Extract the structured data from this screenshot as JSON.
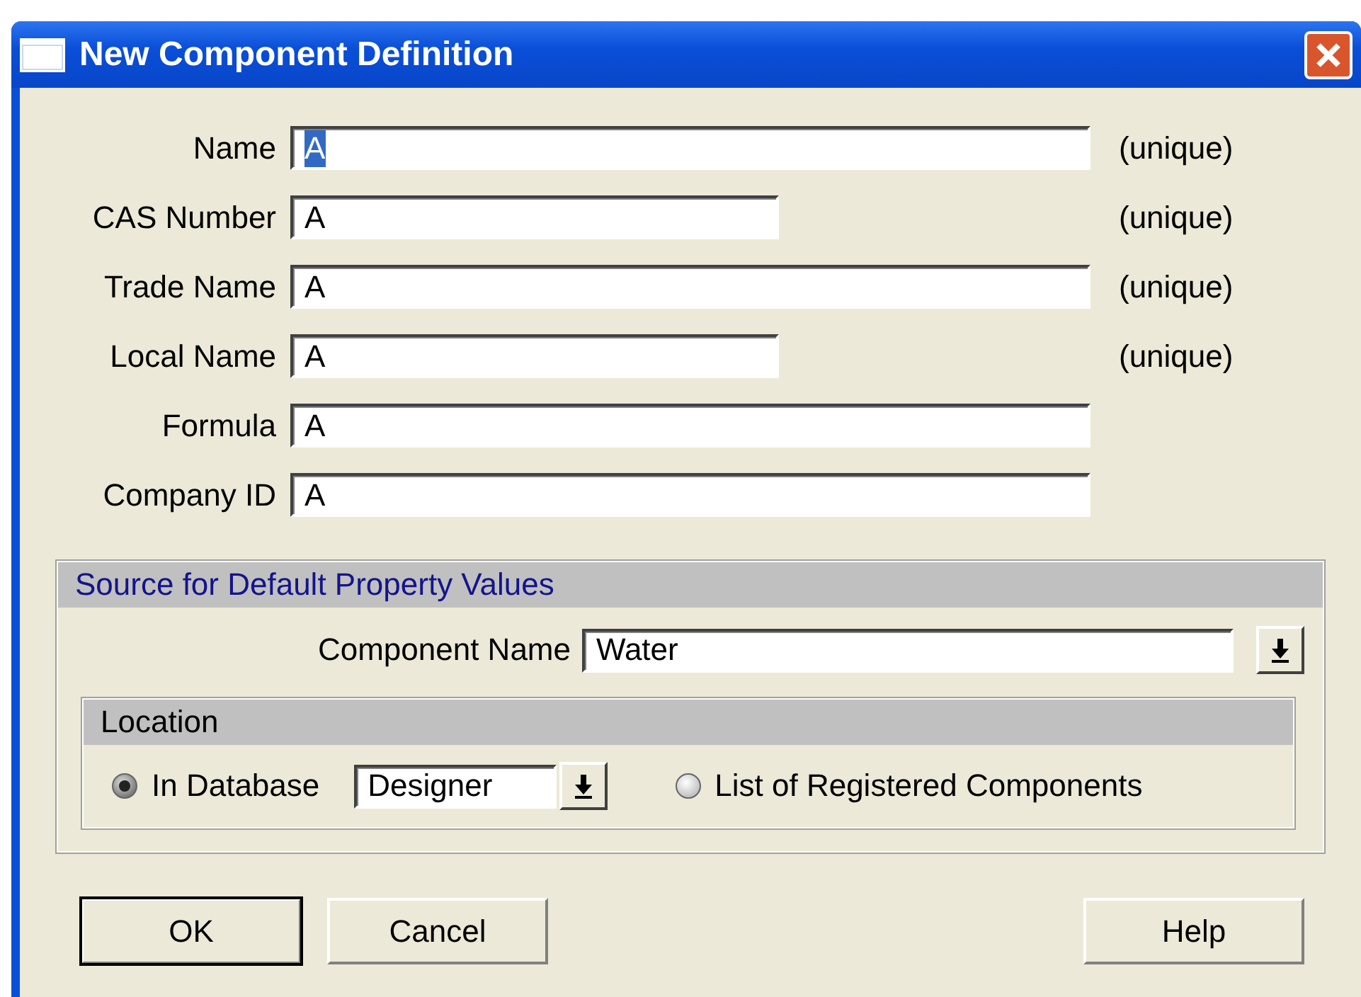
{
  "window": {
    "title": "New Component Definition"
  },
  "fields": [
    {
      "label": "Name",
      "value": "A",
      "kind": "wide",
      "text_selected": true,
      "note": "(unique)"
    },
    {
      "label": "CAS Number",
      "value": "A",
      "kind": "narrow",
      "text_selected": false,
      "note": "(unique)"
    },
    {
      "label": "Trade Name",
      "value": "A",
      "kind": "wide",
      "text_selected": false,
      "note": "(unique)"
    },
    {
      "label": "Local Name",
      "value": "A",
      "kind": "narrow",
      "text_selected": false,
      "note": "(unique)"
    },
    {
      "label": "Formula",
      "value": "A",
      "kind": "wide",
      "text_selected": false
    },
    {
      "label": "Company ID",
      "value": "A",
      "kind": "wide",
      "text_selected": false
    }
  ],
  "source": {
    "title": "Source for Default Property Values",
    "component_name": {
      "label": "Component Name",
      "value": "Water"
    },
    "location": {
      "title": "Location",
      "options": [
        {
          "label": "In Database",
          "selected": true,
          "database": "Designer"
        },
        {
          "label": "List of Registered Components",
          "selected": false
        }
      ]
    }
  },
  "buttons": [
    {
      "label": "OK",
      "default": true
    },
    {
      "label": "Cancel",
      "default": false
    },
    {
      "label": "Help",
      "default": false
    }
  ]
}
